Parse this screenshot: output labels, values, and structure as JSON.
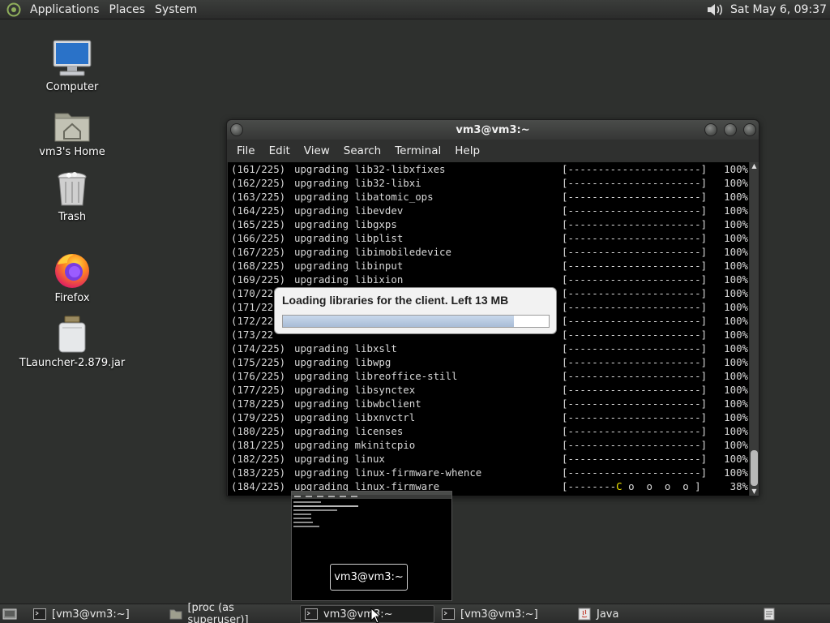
{
  "top_panel": {
    "menus": [
      "Applications",
      "Places",
      "System"
    ],
    "clock": "Sat May  6, 09:37",
    "logo_icon": "mate-logo-icon",
    "volume_icon": "speaker-icon"
  },
  "desktop_icons": [
    {
      "label": "Computer",
      "icon": "computer-icon"
    },
    {
      "label": "vm3's Home",
      "icon": "home-folder-icon"
    },
    {
      "label": "Trash",
      "icon": "trash-icon"
    },
    {
      "label": "Firefox",
      "icon": "firefox-icon"
    },
    {
      "label": "TLauncher-2.879.jar",
      "icon": "jar-file-icon"
    }
  ],
  "terminal": {
    "title": "vm3@vm3:~",
    "menu": [
      "File",
      "Edit",
      "View",
      "Search",
      "Terminal",
      "Help"
    ],
    "lines": [
      {
        "num": "(161/225)",
        "action": "upgrading lib32-libxfixes",
        "bar": "[----------------------]",
        "pct": "100%"
      },
      {
        "num": "(162/225)",
        "action": "upgrading lib32-libxi",
        "bar": "[----------------------]",
        "pct": "100%"
      },
      {
        "num": "(163/225)",
        "action": "upgrading libatomic_ops",
        "bar": "[----------------------]",
        "pct": "100%"
      },
      {
        "num": "(164/225)",
        "action": "upgrading libevdev",
        "bar": "[----------------------]",
        "pct": "100%"
      },
      {
        "num": "(165/225)",
        "action": "upgrading libgxps",
        "bar": "[----------------------]",
        "pct": "100%"
      },
      {
        "num": "(166/225)",
        "action": "upgrading libplist",
        "bar": "[----------------------]",
        "pct": "100%"
      },
      {
        "num": "(167/225)",
        "action": "upgrading libimobiledevice",
        "bar": "[----------------------]",
        "pct": "100%"
      },
      {
        "num": "(168/225)",
        "action": "upgrading libinput",
        "bar": "[----------------------]",
        "pct": "100%"
      },
      {
        "num": "(169/225)",
        "action": "upgrading libixion",
        "bar": "[----------------------]",
        "pct": "100%"
      },
      {
        "num": "(170/22",
        "action": "",
        "bar": "[----------------------]",
        "pct": "100%"
      },
      {
        "num": "(171/22",
        "action": "",
        "bar": "[----------------------]",
        "pct": "100%"
      },
      {
        "num": "(172/22",
        "action": "",
        "bar": "[----------------------]",
        "pct": "100%"
      },
      {
        "num": "(173/22",
        "action": "",
        "bar": "[----------------------]",
        "pct": "100%"
      },
      {
        "num": "(174/225)",
        "action": "upgrading libxslt",
        "bar": "[----------------------]",
        "pct": "100%"
      },
      {
        "num": "(175/225)",
        "action": "upgrading libwpg",
        "bar": "[----------------------]",
        "pct": "100%"
      },
      {
        "num": "(176/225)",
        "action": "upgrading libreoffice-still",
        "bar": "[----------------------]",
        "pct": "100%"
      },
      {
        "num": "(177/225)",
        "action": "upgrading libsynctex",
        "bar": "[----------------------]",
        "pct": "100%"
      },
      {
        "num": "(178/225)",
        "action": "upgrading libwbclient",
        "bar": "[----------------------]",
        "pct": "100%"
      },
      {
        "num": "(179/225)",
        "action": "upgrading libxnvctrl",
        "bar": "[----------------------]",
        "pct": "100%"
      },
      {
        "num": "(180/225)",
        "action": "upgrading licenses",
        "bar": "[----------------------]",
        "pct": "100%"
      },
      {
        "num": "(181/225)",
        "action": "upgrading mkinitcpio",
        "bar": "[----------------------]",
        "pct": "100%"
      },
      {
        "num": "(182/225)",
        "action": "upgrading linux",
        "bar": "[----------------------]",
        "pct": "100%"
      },
      {
        "num": "(183/225)",
        "action": "upgrading linux-firmware-whence",
        "bar": "[----------------------]",
        "pct": "100%"
      },
      {
        "num": "(184/225)",
        "action": "upgrading linux-firmware",
        "bar": "[--------C o  o  o  o ]",
        "pct": "38%"
      }
    ]
  },
  "loading_dialog": {
    "text": "Loading libraries for the client. Left 13 MB",
    "progress": 0.87
  },
  "window_preview": {
    "label": "vm3@vm3:~"
  },
  "taskbar": {
    "items": [
      {
        "label": "[vm3@vm3:~]",
        "icon": "terminal-icon",
        "active": false
      },
      {
        "label": "[proc (as superuser)]",
        "icon": "folder-icon",
        "active": false
      },
      {
        "label": "vm3@vm3:~",
        "icon": "terminal-icon",
        "active": true
      },
      {
        "label": "[vm3@vm3:~]",
        "icon": "terminal-icon",
        "active": false
      },
      {
        "label": "Java",
        "icon": "java-icon",
        "active": false
      }
    ],
    "show_desktop_icon": "show-desktop-icon",
    "workspace_icon": "workspace-switcher-icon"
  }
}
